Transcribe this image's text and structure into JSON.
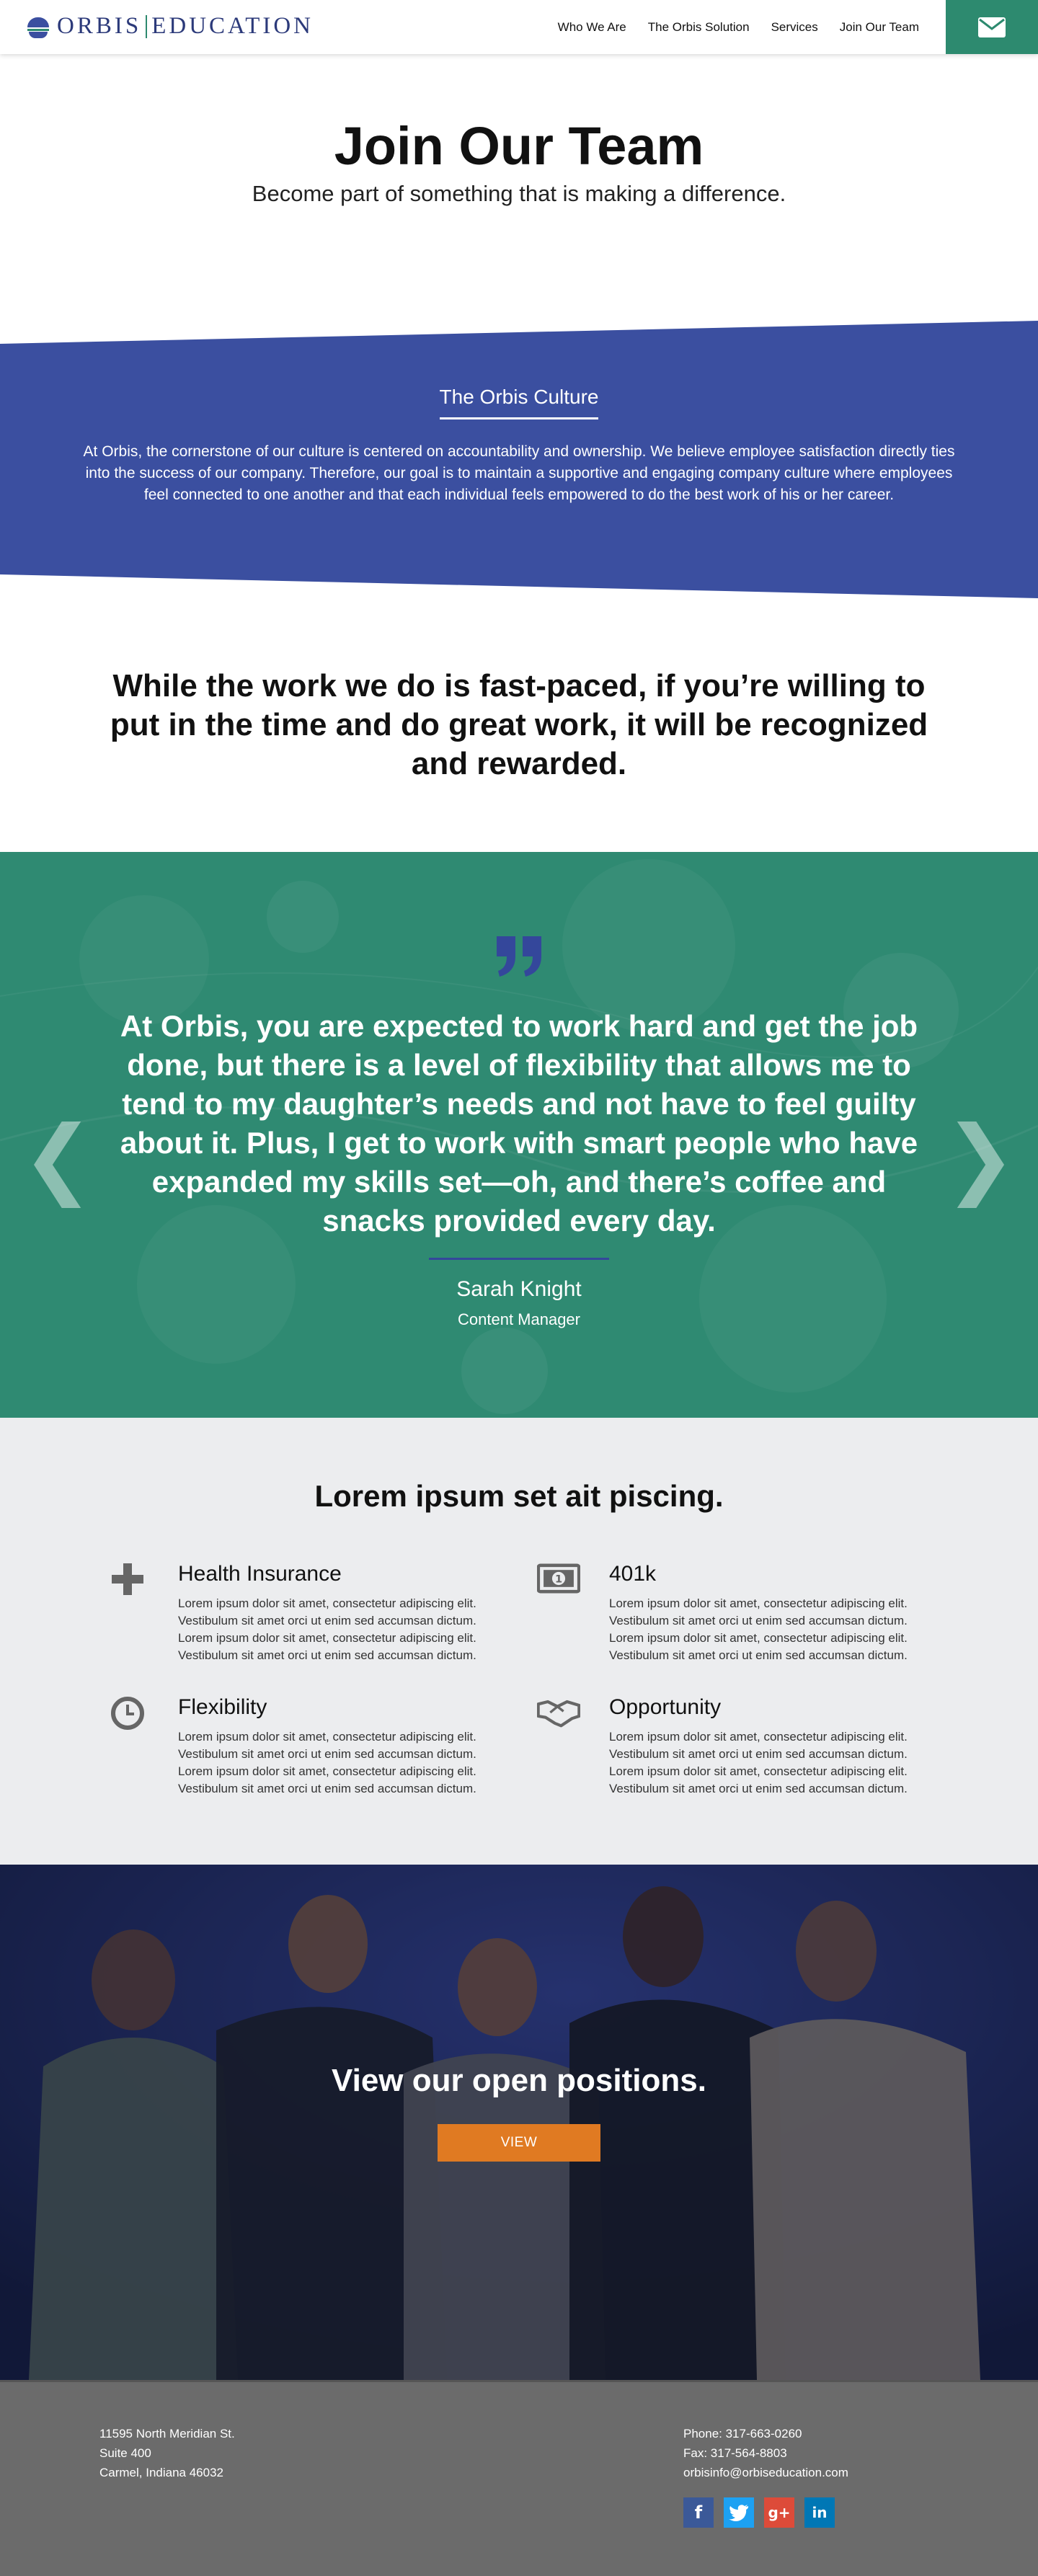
{
  "header": {
    "logo_left": "ORBIS",
    "logo_right": "EDUCATION",
    "nav": [
      "Who We Are",
      "The Orbis Solution",
      "Services",
      "Join Our Team"
    ]
  },
  "hero": {
    "title": "Join Our Team",
    "subtitle": "Become part of something that is making a difference."
  },
  "culture": {
    "heading": "The Orbis Culture",
    "body": "At Orbis, the cornerstone of our culture is centered on accountability and ownership. We believe employee satisfaction directly ties into the success of our company. Therefore, our goal is to maintain a supportive and engaging company culture where employees feel connected to one another and that each individual feels empowered to do the best work of his or her career."
  },
  "statement": "While the work we do is fast-paced, if you’re willing to put in the time and do great work, it will be recognized and rewarded.",
  "testimonial": {
    "quote": "At Orbis, you are expected to work hard and get the job done, but there is a level of flexibility that allows me to tend to my daughter’s needs and not have to feel guilty about it. Plus, I get to work with smart people who have expanded my skills set—oh, and there’s coffee and snacks provided every day.",
    "name": "Sarah Knight",
    "role": "Content Manager",
    "prev": "❮",
    "next": "❯"
  },
  "benefits": {
    "heading": "Lorem ipsum set ait piscing.",
    "items": [
      {
        "title": "Health Insurance",
        "icon": "plus-icon",
        "text": "Lorem ipsum dolor sit amet, consectetur adipiscing elit. Vestibulum sit amet orci ut enim sed accumsan dictum. Lorem ipsum dolor sit amet, consectetur adipiscing elit. Vestibulum sit amet orci ut enim sed accumsan dictum."
      },
      {
        "title": "401k",
        "icon": "money-icon",
        "text": "Lorem ipsum dolor sit amet, consectetur adipiscing elit. Vestibulum sit amet orci ut enim sed accumsan dictum. Lorem ipsum dolor sit amet, consectetur adipiscing elit. Vestibulum sit amet orci ut enim sed accumsan dictum."
      },
      {
        "title": "Flexibility",
        "icon": "clock-icon",
        "text": "Lorem ipsum dolor sit amet, consectetur adipiscing elit. Vestibulum sit amet orci ut enim sed accumsan dictum. Lorem ipsum dolor sit amet, consectetur adipiscing elit. Vestibulum sit amet orci ut enim sed accumsan dictum."
      },
      {
        "title": "Opportunity",
        "icon": "handshake-icon",
        "text": "Lorem ipsum dolor sit amet, consectetur adipiscing elit. Vestibulum sit amet orci ut enim sed accumsan dictum. Lorem ipsum dolor sit amet, consectetur adipiscing elit. Vestibulum sit amet orci ut enim sed accumsan dictum."
      }
    ]
  },
  "positions": {
    "heading": "View our open positions.",
    "button": "VIEW"
  },
  "footer": {
    "address": [
      "11595 North Meridian St.",
      "Suite 400",
      "Carmel, Indiana 46032"
    ],
    "phone": "Phone: 317-663-0260",
    "fax": "Fax: 317-564-8803",
    "email": "orbisinfo@orbiseducation.com",
    "socials": [
      {
        "name": "facebook-icon",
        "glyph": "f",
        "color": "#3b5998"
      },
      {
        "name": "twitter-icon",
        "glyph": "t",
        "color": "#1da1f2"
      },
      {
        "name": "google-plus-icon",
        "glyph": "g+",
        "color": "#dd4b39"
      },
      {
        "name": "linkedin-icon",
        "glyph": "in",
        "color": "#0077b5"
      }
    ]
  },
  "colors": {
    "brand_blue": "#3b4fa0",
    "brand_green": "#2d8a6f",
    "accent_orange": "#e07a22",
    "footer_gray": "#6b6b6b"
  }
}
